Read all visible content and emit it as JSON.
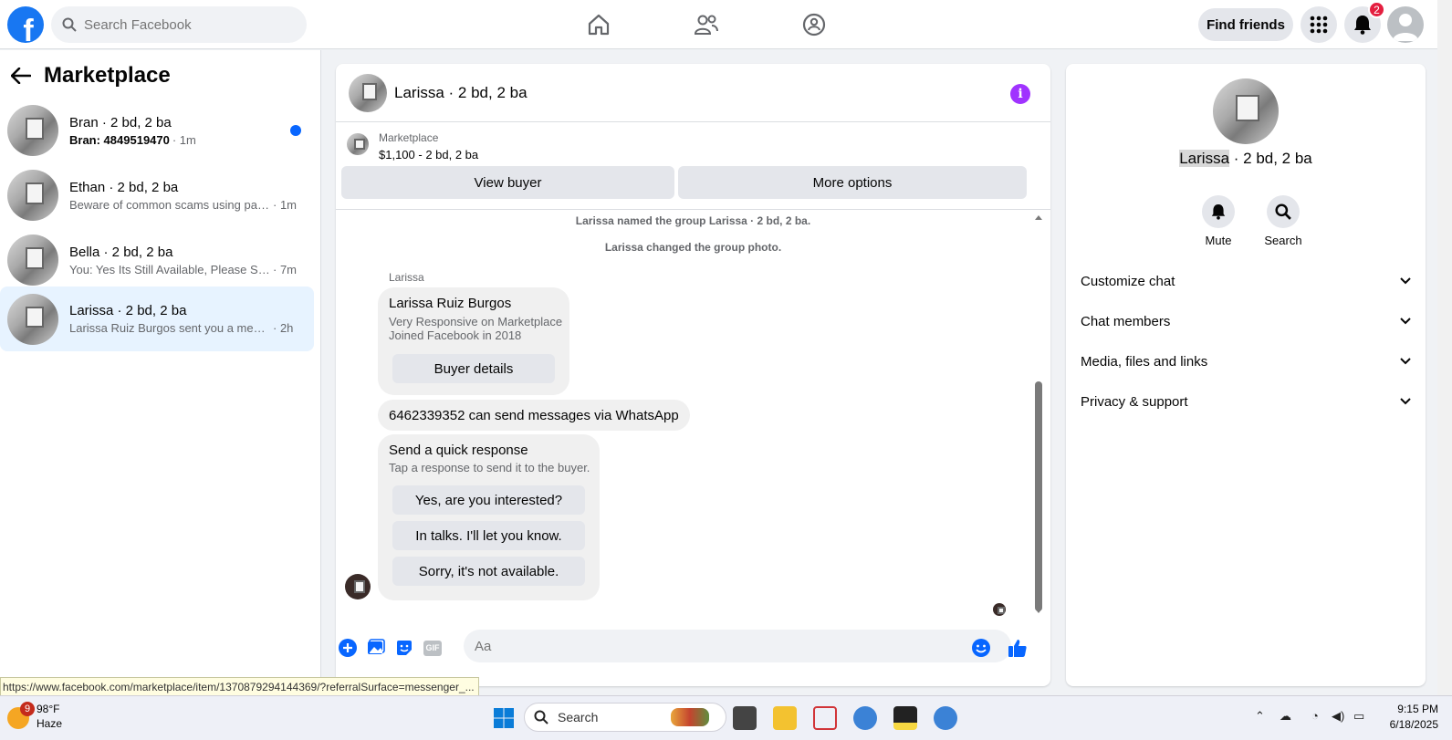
{
  "topbar": {
    "logo_letter": "f",
    "search_placeholder": "Search Facebook",
    "find_friends": "Find friends",
    "notifications_count": "2"
  },
  "sidebar": {
    "title": "Marketplace",
    "conversations": [
      {
        "title": "Bran · 2 bd, 2 ba",
        "preview": "Bran: 4849519470",
        "time": "· 1m",
        "unread": true
      },
      {
        "title": "Ethan · 2 bd, 2 ba",
        "preview": "Beware of common scams using pay...",
        "time": " · 1m",
        "unread": false
      },
      {
        "title": "Bella · 2 bd, 2 ba",
        "preview": "You: Yes Its Still Available, Please Sen...",
        "time": " · 7m",
        "unread": false
      },
      {
        "title": "Larissa · 2 bd, 2 ba",
        "preview": "Larissa Ruiz Burgos sent you a messa...",
        "time": " · 2h",
        "unread": false,
        "active": true
      }
    ]
  },
  "chat": {
    "header_name": "Larissa · 2 bd, 2 ba",
    "listing_label": "Marketplace",
    "listing_title": "$1,100 - 2 bd, 2 ba",
    "view_buyer": "View buyer",
    "more_options": "More options",
    "system_1": "Larissa named the group Larissa · 2 bd, 2 ba.",
    "system_2": "Larissa changed the group photo.",
    "sender": "Larissa",
    "profile_card": {
      "name": "Larissa Ruiz Burgos",
      "line1": "Very Responsive on Marketplace",
      "line2": "Joined Facebook in 2018",
      "button": "Buyer details"
    },
    "whatsapp_msg": "6462339352 can send messages via WhatsApp",
    "quick": {
      "title": "Send a quick response",
      "sub": "Tap a response to send it to the buyer.",
      "options": [
        "Yes, are you interested?",
        "In talks. I'll let you know.",
        "Sorry, it's not available."
      ]
    },
    "composer_placeholder": "Aa",
    "gif_label": "GIF"
  },
  "details": {
    "name_highlight": "Larissa",
    "name_rest": " · 2 bd, 2 ba",
    "mute": "Mute",
    "search": "Search",
    "sections": [
      "Customize chat",
      "Chat members",
      "Media, files and links",
      "Privacy & support"
    ]
  },
  "status_url": "https://www.facebook.com/marketplace/item/1370879294144369/?referralSurface=messenger_...",
  "taskbar": {
    "weather_badge": "9",
    "temp": "98°F",
    "condition": "Haze",
    "search": "Search",
    "time": "9:15 PM",
    "date": "6/18/2025"
  },
  "colors": {
    "brand": "#1877f2",
    "unread_dot": "#0866ff",
    "info": "#a033ff",
    "notification": "#e41e3f"
  }
}
